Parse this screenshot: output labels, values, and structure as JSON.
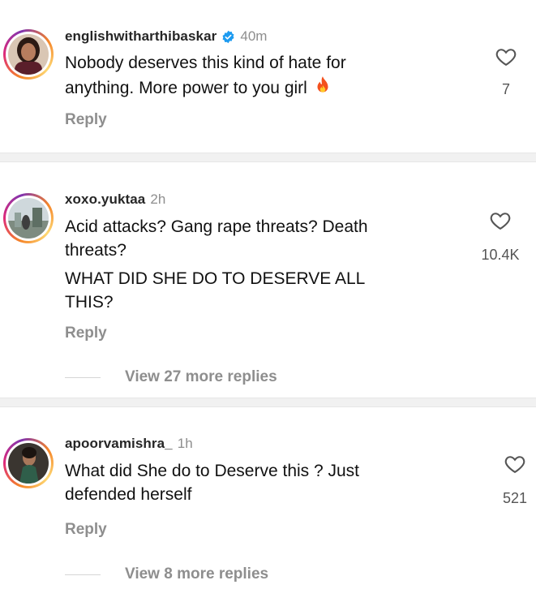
{
  "comments": [
    {
      "username": "englishwitharthibaskar",
      "verified": true,
      "time": "40m",
      "lines": [
        "Nobody deserves this kind of hate for",
        "anything. More power to you girl"
      ],
      "emoji": "fire-icon",
      "reply_label": "Reply",
      "likes": "7"
    },
    {
      "username": "xoxo.yuktaa",
      "verified": false,
      "time": "2h",
      "lines": [
        "Acid attacks? Gang rape threats? Death",
        "threats?",
        "WHAT DID SHE DO TO DESERVE ALL",
        "THIS?"
      ],
      "reply_label": "Reply",
      "likes": "10.4K",
      "more_replies": "View 27 more replies"
    },
    {
      "username": "apoorvamishra_",
      "verified": false,
      "time": "1h",
      "lines": [
        "What did She do to Deserve this ? Just",
        "defended herself"
      ],
      "reply_label": "Reply",
      "likes": "521",
      "more_replies": "View 8 more replies"
    }
  ],
  "colors": {
    "verified": "#1d9bf0",
    "muted": "#8e8e8e",
    "separator": "#f1f1f1"
  }
}
